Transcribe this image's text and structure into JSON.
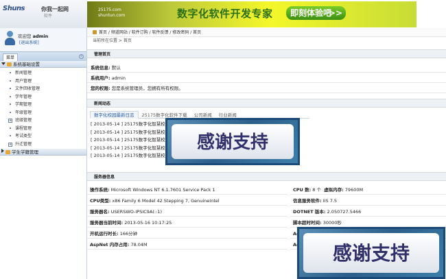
{
  "header": {
    "brand": "Shuns",
    "slogan": "你我一起网",
    "sub": "软件",
    "ad_site_name": "25175.com",
    "ad_site_url": "shuntun.com",
    "ad_slogan": "数字化软件开发专家",
    "ad_cta": "即刻体验吧",
    "ad_cta_arrow": ">>"
  },
  "user": {
    "welcome_label": "欢迎您",
    "username": "admin",
    "logout": "[退出系统]"
  },
  "sidebar": {
    "tab": "菜单",
    "ctrl": "«",
    "group1": "系统基础设置",
    "items": [
      {
        "label": "新闻管理",
        "expandable": false
      },
      {
        "label": "用户管理",
        "expandable": false
      },
      {
        "label": "文件回收管理",
        "expandable": false
      },
      {
        "label": "学年管理",
        "expandable": false
      },
      {
        "label": "学期管理",
        "expandable": false
      },
      {
        "label": "年级管理",
        "expandable": false
      },
      {
        "label": "班级管理",
        "expandable": true
      },
      {
        "label": "课程管理",
        "expandable": false
      },
      {
        "label": "考试类型",
        "expandable": false
      },
      {
        "label": "升迁管理",
        "expandable": true
      }
    ],
    "group2": "学生学籍管理"
  },
  "breadcrumb": "首页 / 频道网站 / 软件订购 / 软件反馈 / 修改密码 / 首页",
  "location": "当前所在位置 > 首页",
  "admin_panel": {
    "title": "管理首页",
    "info_label": "系统信息:",
    "info_value": "默认",
    "user_label": "系统用户:",
    "user_value": "admin",
    "perm_label": "您的权限:",
    "perm_value": "您是系统管理员，您拥有所有权限。"
  },
  "news": {
    "title": "新闻动态",
    "tabs": [
      "数字化校园最新日志",
      "25175数字化软件下载",
      "公司新闻",
      "行业新闻"
    ],
    "items": [
      "[ 2013-05-14 ] 25175数字化智慧校园",
      "[ 2013-05-14 ] 25175数字化智慧校园",
      "[ 2013-05-14 ] 25175数字化智慧校园",
      "[ 2013-05-14 ] 25175数字化智慧校园",
      "[ 2013-05-14 ] 25175数字化智慧校园"
    ]
  },
  "overlay_text": "感谢支持",
  "server": {
    "title": "服务器信息",
    "left": [
      {
        "label": "操作系统:",
        "value": "Microsoft Windows NT 6.1.7601 Service Pack 1"
      },
      {
        "label": "CPU类型:",
        "value": "x86 Family 6 Model 42 Stepping 7, GenuineIntel"
      },
      {
        "label": "服务器名:",
        "value": "USERSWO-IPSIC9A(::1)"
      },
      {
        "label": "服务器当前时间:",
        "value": "2013-05-16 10:17:25"
      },
      {
        "label": "开机运行时长:",
        "value": "166分钟"
      },
      {
        "label": "AspNet 内存占用:",
        "value": "78.04M"
      }
    ],
    "right": [
      {
        "label": "CPU 数:",
        "value": "8 个",
        "label2": "虚拟内存:",
        "value2": "79600M"
      },
      {
        "label": "信息服务软件:",
        "value": "IIS 7.5"
      },
      {
        "label": "DOTNET 版本:",
        "value": "2.050727.5466"
      },
      {
        "label": "脚本超时时间:",
        "value": "30000秒"
      },
      {
        "label": "AspNet",
        "value": ""
      },
      {
        "label": "AspNet",
        "value": ""
      }
    ]
  }
}
